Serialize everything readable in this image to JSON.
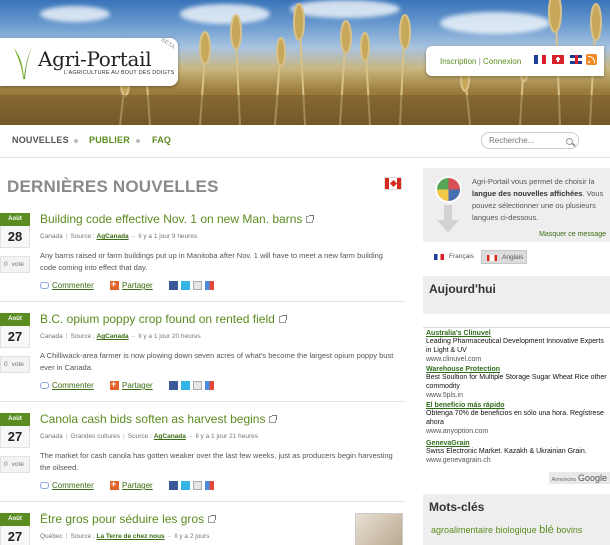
{
  "header": {
    "logo_title": "Agri-Portail",
    "logo_tagline": "L'AGRICULTURE AU BOUT DES DOIGTS",
    "beta": "BETA",
    "signup": "Inscription",
    "auth_separator": "|",
    "login": "Connexion"
  },
  "nav": {
    "news": "NOUVELLES",
    "publish": "PUBLIER",
    "faq": "FAQ",
    "search_placeholder": "Recherche..."
  },
  "main": {
    "section_title": "DERNIÈRES NOUVELLES",
    "articles": [
      {
        "month": "Août",
        "day": "28",
        "votes": "0",
        "vote_label": "vote",
        "title": "Building code effective Nov. 1 on new Man. barns",
        "region": "Canada",
        "source_label": "Source :",
        "source": "AgCanada",
        "time": "Il y a 1 jour 9 heures",
        "text": "Any barns raised or farm buildings put up in Manitoba after Nov. 1 will have to meet a new farm building code coming into effect that day.",
        "comment": "Commenter",
        "share": "Partager"
      },
      {
        "month": "Août",
        "day": "27",
        "votes": "0",
        "vote_label": "vote",
        "title": "B.C. opium poppy crop found on rented field",
        "region": "Canada",
        "source_label": "Source :",
        "source": "AgCanada",
        "time": "Il y a 1 jour 20 heures",
        "text": "A Chilliwack-area farmer is now plowing down seven acres of what's become the largest opium poppy bust ever in Canada.",
        "comment": "Commenter",
        "share": "Partager"
      },
      {
        "month": "Août",
        "day": "27",
        "votes": "0",
        "vote_label": "vote",
        "title": "Canola cash bids soften as harvest begins",
        "region": "Canada",
        "category": "Grandes cultures",
        "source_label": "Source :",
        "source": "AgCanada",
        "time": "Il y a 1 jour 21 heures",
        "text": "The market for cash canola has gotten weaker over the last few weeks, just as producers begin harvesting the oilseed.",
        "comment": "Commenter",
        "share": "Partager"
      },
      {
        "month": "Août",
        "day": "27",
        "title": "Être gros pour séduire les gros",
        "region": "Québec",
        "source_label": "Source :",
        "source": "La Terre de chez nous",
        "time": "Il y a 2 jours"
      }
    ]
  },
  "sidebar": {
    "lang_text_1": "Agri-Portail vous permet de choisir la ",
    "lang_text_bold": "langue des nouvelles affichées",
    "lang_text_2": ". Vous pouvez sélectionner une ou plusieurs langues ci-dessous.",
    "hide_message": "Masquer ce message",
    "lang_fr": "Français",
    "lang_en": "Anglais",
    "today_heading": "Aujourd'hui",
    "ads": [
      {
        "title": "Australia's Clinuvel",
        "desc": "Leading Pharmaceutical Development Innovative Experts in Light & UV",
        "url": "www.clinuvel.com"
      },
      {
        "title": "Warehouse Protection",
        "desc": "Best Soultion for Multiple Storage Sugar Wheat Rice other commodity",
        "url": "www.5pls.in"
      },
      {
        "title": "El beneficio más rápido",
        "desc": "Obtenga 70% de beneficios en sólo una hora. Regístrese ahora",
        "url": "www.anyoption.com"
      },
      {
        "title": "GenevaGrain",
        "desc": "Swiss Electronic Market. Kazakh & Ukrainian Grain.",
        "url": "www.genevagrain.ch"
      }
    ],
    "ads_by": "Annonces",
    "google": "Google",
    "tags_heading": "Mots-clés",
    "tags": [
      "agroalimentaire",
      "biologique",
      "blé",
      "bovins"
    ]
  }
}
